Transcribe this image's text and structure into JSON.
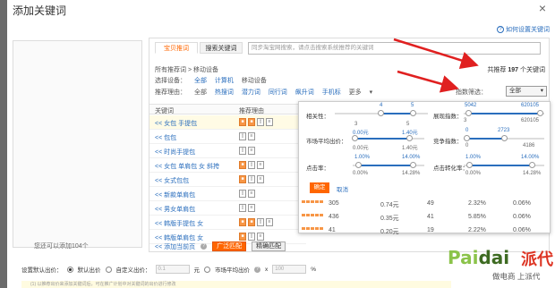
{
  "dialog": {
    "title": "添加关键词",
    "close": "×",
    "help_link": "如何设置关键词"
  },
  "left_panel": {
    "footer": "您还可以添加104个"
  },
  "tabs": [
    {
      "label": "宝贝推词",
      "active": true
    },
    {
      "label": "搜索关键词",
      "active": false
    }
  ],
  "search": {
    "placeholder": "同步淘宝网搜索，请点击搜索系统推荐的关键词",
    "button_icon": "search-icon"
  },
  "crumb": "所有推荐词 > 移动设备",
  "device_row": {
    "label": "选择设备：",
    "options": [
      "全部",
      "计算机",
      "移动设备"
    ]
  },
  "reason_row": {
    "label": "推荐理由：",
    "options": [
      "全部",
      "热搜词",
      "潜力词",
      "同行词",
      "飙升词",
      "手机标"
    ],
    "more": "更多"
  },
  "total": {
    "prefix": "共推荐",
    "count": "197",
    "suffix": "个关键词"
  },
  "filter": {
    "label": "指数筛选：",
    "value": "全部"
  },
  "table_head": {
    "col1": "关键词",
    "col2": "推荐理由"
  },
  "keywords": [
    {
      "text": "<< 女包 手提包",
      "highlight": true,
      "icons": [
        "orange",
        "orange",
        "phone",
        "doc"
      ]
    },
    {
      "text": "<< 包包",
      "highlight": false,
      "icons": [
        "phone",
        "doc"
      ]
    },
    {
      "text": "<< 时尚手提包",
      "highlight": false,
      "icons": [
        "phone",
        "doc"
      ]
    },
    {
      "text": "<< 女包 单肩包 女 斜挎",
      "highlight": false,
      "icons": [
        "orange",
        "phone",
        "doc"
      ]
    },
    {
      "text": "<< 女式包包",
      "highlight": false,
      "icons": [
        "orange",
        "phone",
        "doc"
      ]
    },
    {
      "text": "<< 新款单肩包",
      "highlight": false,
      "icons": [
        "phone",
        "doc"
      ]
    },
    {
      "text": "<< 男女单肩包",
      "highlight": false,
      "icons": [
        "phone",
        "doc"
      ]
    },
    {
      "text": "<< 韩版手提包 女",
      "highlight": false,
      "icons": [
        "orange",
        "orange",
        "phone",
        "doc"
      ]
    },
    {
      "text": "<< 韩版单肩包 女",
      "highlight": false,
      "icons": [
        "orange",
        "phone",
        "doc"
      ]
    }
  ],
  "popup": {
    "relevance": {
      "label": "相关性：",
      "min": "4",
      "max": "5"
    },
    "display_index": {
      "label": "展现指数：",
      "min": "5042",
      "max": "620105",
      "lo": "3",
      "hi": "620105"
    },
    "market_cpc": {
      "label": "市场平均出价：",
      "min": "0.00元",
      "max": "1.40元",
      "lo": "0.00元",
      "hi": "1.40元"
    },
    "competition": {
      "label": "竞争指数：",
      "min": "0",
      "max": "2723",
      "lo": "0",
      "hi": "4186"
    },
    "ctr": {
      "label": "点击率：",
      "min": "1.00%",
      "max": "14.00%",
      "lo": "0.00%",
      "hi": "14.28%"
    },
    "cvr": {
      "label": "点击转化率：",
      "min": "1.00%",
      "max": "14.00%",
      "lo": "0.00%",
      "hi": "14.28%"
    },
    "ok": "确定",
    "cancel": "取消"
  },
  "data_rows": [
    {
      "impressions": "305",
      "cpc": "0.74元",
      "comp": "49",
      "ctr": "2.32%",
      "cvr": "0.06%"
    },
    {
      "impressions": "436",
      "cpc": "0.35元",
      "comp": "41",
      "ctr": "5.85%",
      "cvr": "0.06%"
    },
    {
      "impressions": "41",
      "cpc": "0.20元",
      "comp": "19",
      "ctr": "2.22%",
      "cvr": "0.06%"
    }
  ],
  "table_footer": {
    "add_page": "<< 添加当前页",
    "match_broad": "广泛匹配",
    "match_exact": "精确匹配"
  },
  "bottom": {
    "label": "设置默认出价：",
    "opt1": "默认出价",
    "opt2": "自定义出价：",
    "custom_value": "0.1",
    "unit": "元",
    "opt3": "市场平均出价",
    "multiply": "x",
    "pct_value": "100",
    "pct": "%"
  },
  "warn": "(1) 以推荐出价来添加关键词后，可在推广计划中对关键词的出价进行修改",
  "watermark": {
    "brand_a": "Pai",
    "brand_b": "dai",
    "brand_cn": "派代",
    "tagline": "做电商 上派代"
  }
}
